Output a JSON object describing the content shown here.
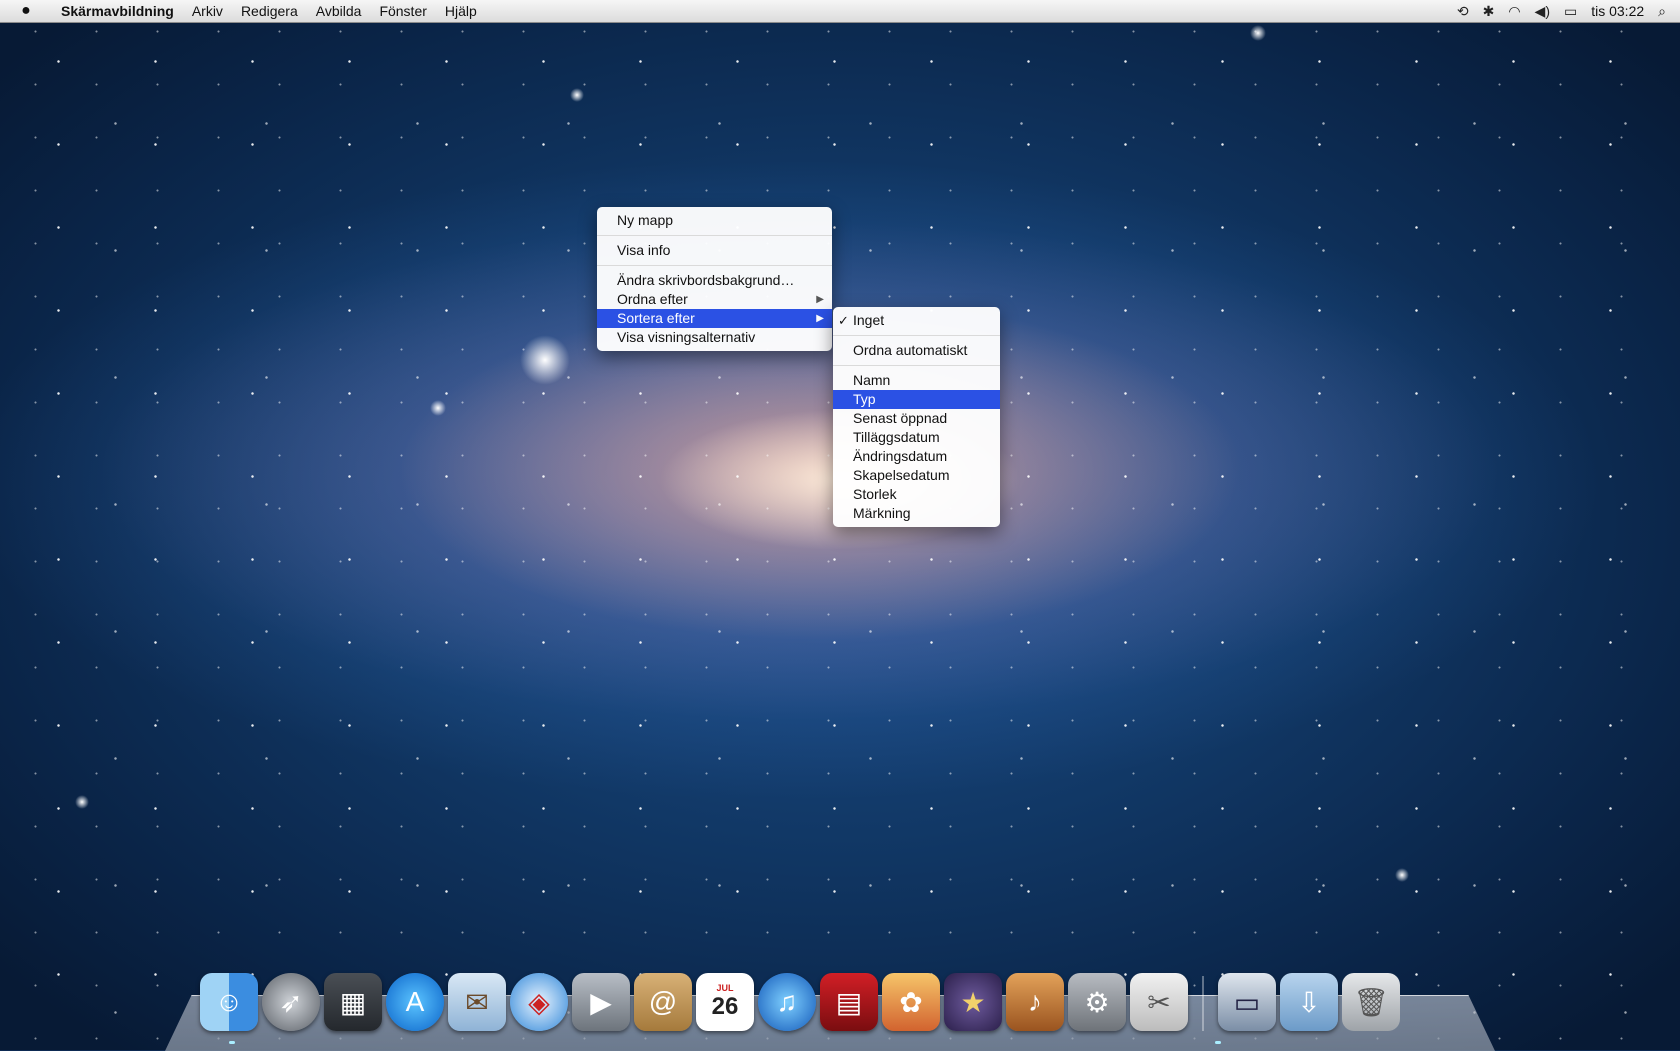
{
  "menubar": {
    "app_name": "Skärmavbildning",
    "items": [
      "Arkiv",
      "Redigera",
      "Avbilda",
      "Fönster",
      "Hjälp"
    ],
    "status_icons": [
      "time-machine-icon",
      "bluetooth-icon",
      "wifi-icon",
      "volume-icon",
      "battery-icon"
    ],
    "clock": "tis 03:22"
  },
  "context_menu": {
    "new_folder": "Ny mapp",
    "get_info": "Visa info",
    "change_background": "Ändra skrivbordsbakgrund…",
    "arrange_by": "Ordna efter",
    "sort_by": "Sortera efter",
    "show_view_options": "Visa visningsalternativ"
  },
  "submenu": {
    "none": "Inget",
    "auto_arrange": "Ordna automatiskt",
    "name": "Namn",
    "kind": "Typ",
    "last_opened": "Senast öppnad",
    "date_added": "Tilläggsdatum",
    "date_modified": "Ändringsdatum",
    "date_created": "Skapelsedatum",
    "size": "Storlek",
    "label": "Märkning"
  },
  "dock": {
    "calendar_month": "JUL",
    "calendar_day": "26",
    "icons": [
      "finder-icon",
      "launchpad-icon",
      "mission-control-icon",
      "app-store-icon",
      "mail-icon",
      "safari-icon",
      "facetime-icon",
      "address-book-icon",
      "calendar-icon",
      "itunes-icon",
      "photo-booth-icon",
      "iphoto-icon",
      "imovie-icon",
      "garageband-icon",
      "system-preferences-icon",
      "grab-icon",
      "screenshots-stack-icon",
      "downloads-folder-icon",
      "trash-icon"
    ]
  },
  "colors": {
    "selection": "#2b51e4"
  }
}
